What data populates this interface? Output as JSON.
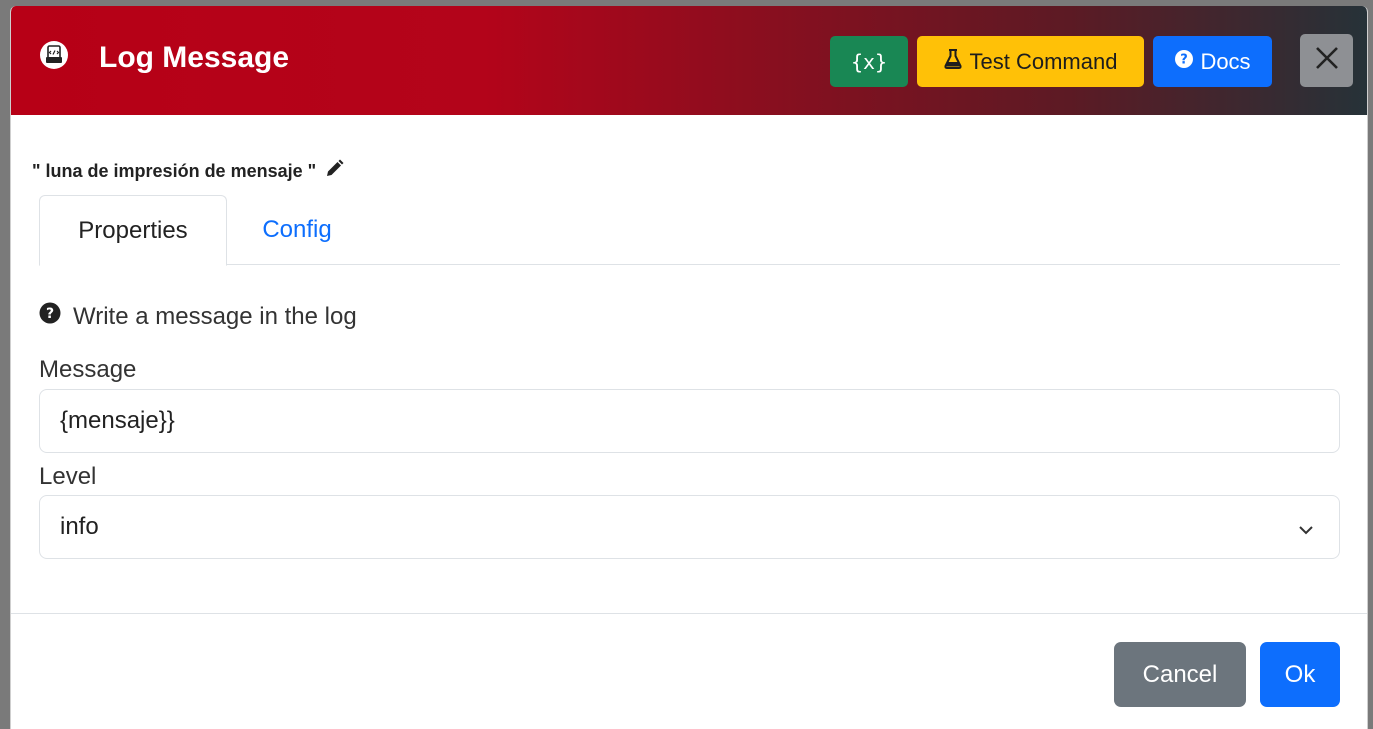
{
  "header": {
    "title": "Log Message",
    "vars_label": "{x}",
    "test_label": "Test Command",
    "docs_label": "Docs",
    "close_label": "✕",
    "gradient_start": "#b70016",
    "gradient_end": "#263238"
  },
  "node": {
    "name": "\" luna de impresión de mensaje \""
  },
  "tabs": [
    {
      "label": "Properties",
      "active": true
    },
    {
      "label": "Config",
      "active": false
    }
  ],
  "form": {
    "help_text": "Write a message in the log",
    "message_label": "Message",
    "message_value": "{mensaje}}",
    "level_label": "Level",
    "level_value": "info"
  },
  "footer": {
    "cancel_label": "Cancel",
    "ok_label": "Ok"
  },
  "colors": {
    "vars_button": "#198754",
    "test_button": "#ffc107",
    "docs_button": "#0d6efd",
    "close_button": "#8e9094",
    "cancel_button": "#6c757d",
    "ok_button": "#0d6efd",
    "link": "#0d6efd"
  },
  "icons": {
    "title": "log-file-icon",
    "test": "flask-icon",
    "docs": "question-circle-icon",
    "close": "close-icon",
    "edit": "pencil-icon",
    "help": "question-circle-icon",
    "select": "chevron-down-icon"
  }
}
